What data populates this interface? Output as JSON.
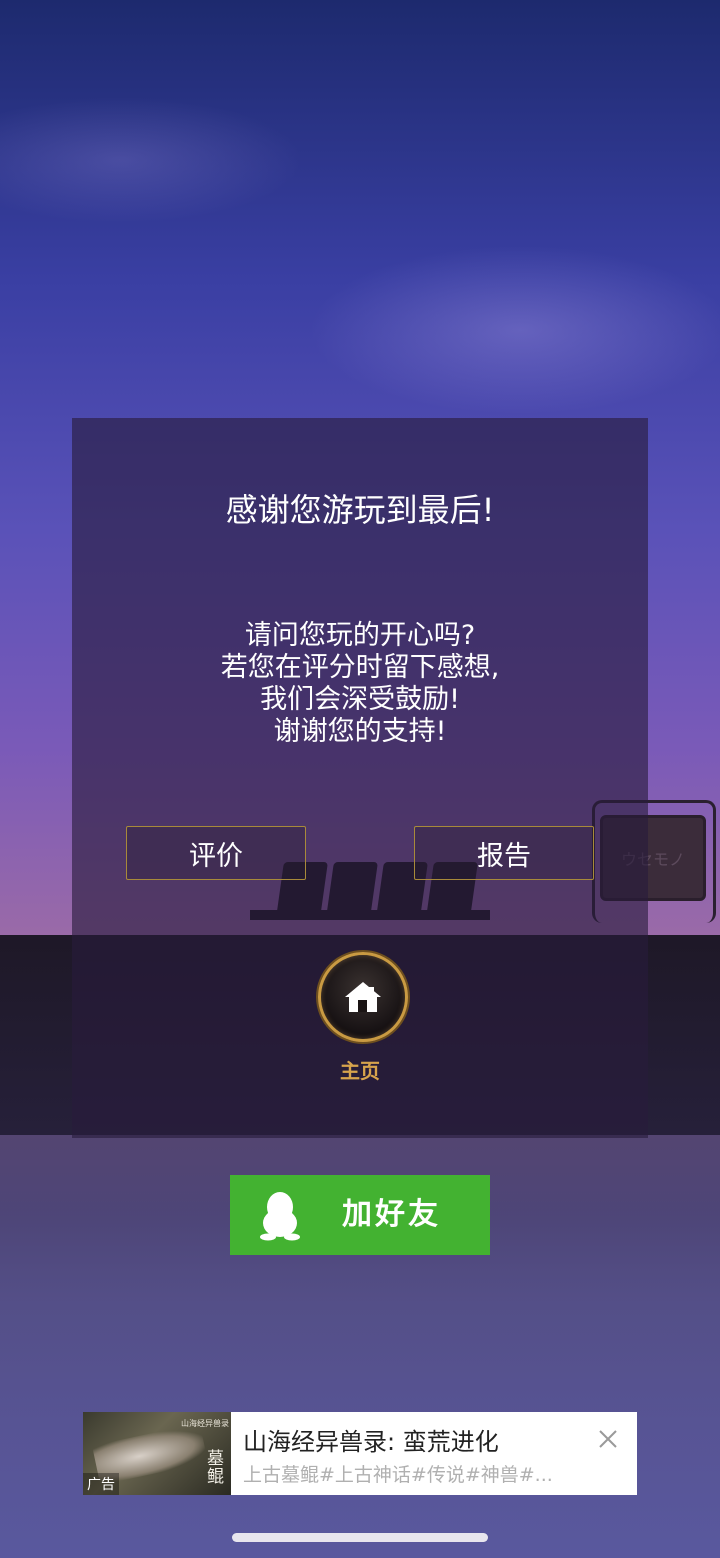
{
  "dialog": {
    "title": "感谢您游玩到最后!",
    "message_lines": [
      "请问您玩的开心吗?",
      "若您在评分时留下感想,",
      "我们会深受鼓励!",
      "谢谢您的支持!"
    ],
    "rate_label": "评价",
    "report_label": "报告",
    "home_label": "主页"
  },
  "background": {
    "sign_text": "ウセモノ"
  },
  "add_friend": {
    "label": "加好友",
    "color": "#43b231"
  },
  "ad": {
    "title": "山海经异兽录: 蛮荒进化",
    "description": "上古墓鲲#上古神话#传说#神兽#...",
    "tag": "广告",
    "thumb_text": "墓鲲",
    "thumb_small_text": "山海经异兽录"
  },
  "colors": {
    "accent_gold": "#c99a42",
    "panel": "rgba(40,28,60,0.62)"
  }
}
